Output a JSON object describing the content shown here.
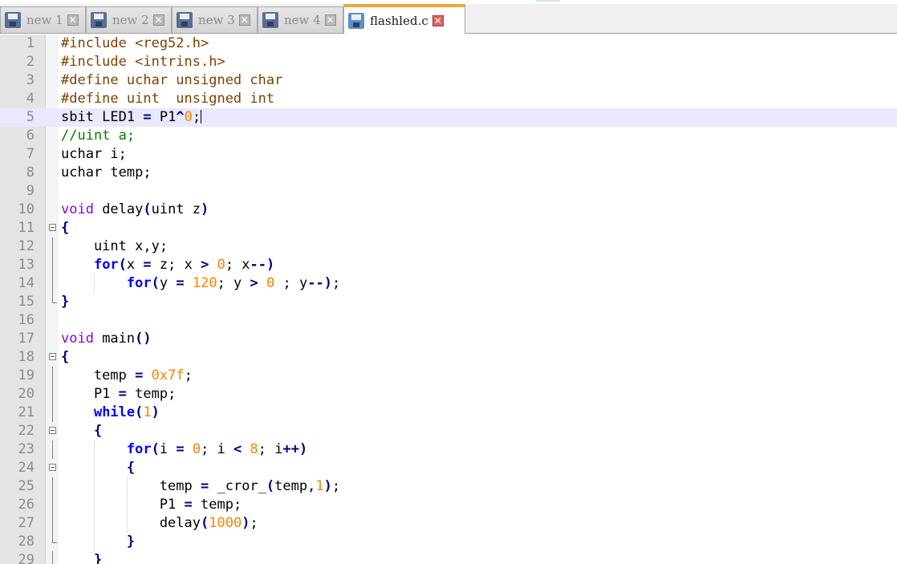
{
  "tabs": [
    {
      "label": "new 1",
      "active": false
    },
    {
      "label": "new 2",
      "active": false
    },
    {
      "label": "new 3",
      "active": false
    },
    {
      "label": "new 4",
      "active": false
    },
    {
      "label": "flashled.c",
      "active": true
    }
  ],
  "close_glyph": "✕",
  "current_line": 5,
  "lines": [
    [
      {
        "t": "#include <reg52.h>",
        "c": "pp"
      }
    ],
    [
      {
        "t": "#include <intrins.h>",
        "c": "pp"
      }
    ],
    [
      {
        "t": "#define uchar unsigned char",
        "c": "pp"
      }
    ],
    [
      {
        "t": "#define uint  unsigned int",
        "c": "pp"
      }
    ],
    [
      {
        "t": "sbit LED1 "
      },
      {
        "t": "=",
        "c": "op"
      },
      {
        "t": " P1"
      },
      {
        "t": "^",
        "c": "op"
      },
      {
        "t": "0",
        "c": "num"
      },
      {
        "t": ";"
      },
      {
        "caret": true
      }
    ],
    [
      {
        "t": "//uint a;",
        "c": "cmt"
      }
    ],
    [
      {
        "t": "uchar i;"
      }
    ],
    [
      {
        "t": "uchar temp;"
      }
    ],
    [],
    [
      {
        "t": "void",
        "c": "kw"
      },
      {
        "t": " delay"
      },
      {
        "t": "(",
        "c": "op"
      },
      {
        "t": "uint z"
      },
      {
        "t": ")",
        "c": "op"
      }
    ],
    [
      {
        "t": "{",
        "c": "op"
      }
    ],
    [
      {
        "t": "    uint x,y;"
      }
    ],
    [
      {
        "t": "    "
      },
      {
        "t": "for",
        "c": "kwb"
      },
      {
        "t": "(",
        "c": "op"
      },
      {
        "t": "x "
      },
      {
        "t": "=",
        "c": "op"
      },
      {
        "t": " z; x "
      },
      {
        "t": ">",
        "c": "op"
      },
      {
        "t": " "
      },
      {
        "t": "0",
        "c": "num"
      },
      {
        "t": "; x"
      },
      {
        "t": "--",
        "c": "op"
      },
      {
        "t": ")",
        "c": "op"
      }
    ],
    [
      {
        "t": "        "
      },
      {
        "t": "for",
        "c": "kwb"
      },
      {
        "t": "(",
        "c": "op"
      },
      {
        "t": "y "
      },
      {
        "t": "=",
        "c": "op"
      },
      {
        "t": " "
      },
      {
        "t": "120",
        "c": "num"
      },
      {
        "t": "; y "
      },
      {
        "t": ">",
        "c": "op"
      },
      {
        "t": " "
      },
      {
        "t": "0",
        "c": "num"
      },
      {
        "t": " ; y"
      },
      {
        "t": "--",
        "c": "op"
      },
      {
        "t": ")",
        "c": "op"
      },
      {
        "t": ";"
      }
    ],
    [
      {
        "t": "}",
        "c": "op"
      }
    ],
    [],
    [
      {
        "t": "void",
        "c": "kw"
      },
      {
        "t": " main"
      },
      {
        "t": "()",
        "c": "op"
      }
    ],
    [
      {
        "t": "{",
        "c": "op"
      }
    ],
    [
      {
        "t": "    temp "
      },
      {
        "t": "=",
        "c": "op"
      },
      {
        "t": " "
      },
      {
        "t": "0x7f",
        "c": "num"
      },
      {
        "t": ";"
      }
    ],
    [
      {
        "t": "    P1 "
      },
      {
        "t": "=",
        "c": "op"
      },
      {
        "t": " temp;"
      }
    ],
    [
      {
        "t": "    "
      },
      {
        "t": "while",
        "c": "kwb"
      },
      {
        "t": "(",
        "c": "op"
      },
      {
        "t": "1",
        "c": "num"
      },
      {
        "t": ")",
        "c": "op"
      }
    ],
    [
      {
        "t": "    "
      },
      {
        "t": "{",
        "c": "op"
      }
    ],
    [
      {
        "t": "        "
      },
      {
        "t": "for",
        "c": "kwb"
      },
      {
        "t": "(",
        "c": "op"
      },
      {
        "t": "i "
      },
      {
        "t": "=",
        "c": "op"
      },
      {
        "t": " "
      },
      {
        "t": "0",
        "c": "num"
      },
      {
        "t": "; i "
      },
      {
        "t": "<",
        "c": "op"
      },
      {
        "t": " "
      },
      {
        "t": "8",
        "c": "num"
      },
      {
        "t": "; i"
      },
      {
        "t": "++",
        "c": "op"
      },
      {
        "t": ")",
        "c": "op"
      }
    ],
    [
      {
        "t": "        "
      },
      {
        "t": "{",
        "c": "op"
      }
    ],
    [
      {
        "t": "            temp "
      },
      {
        "t": "=",
        "c": "op"
      },
      {
        "t": " _cror_"
      },
      {
        "t": "(",
        "c": "op"
      },
      {
        "t": "temp,"
      },
      {
        "t": "1",
        "c": "num"
      },
      {
        "t": ")",
        "c": "op"
      },
      {
        "t": ";"
      }
    ],
    [
      {
        "t": "            P1 "
      },
      {
        "t": "=",
        "c": "op"
      },
      {
        "t": " temp;"
      }
    ],
    [
      {
        "t": "            delay"
      },
      {
        "t": "(",
        "c": "op"
      },
      {
        "t": "1000",
        "c": "num"
      },
      {
        "t": ")",
        "c": "op"
      },
      {
        "t": ";"
      }
    ],
    [
      {
        "t": "        "
      },
      {
        "t": "}",
        "c": "op"
      }
    ],
    [
      {
        "t": "    "
      },
      {
        "t": "}",
        "c": "op"
      }
    ]
  ]
}
